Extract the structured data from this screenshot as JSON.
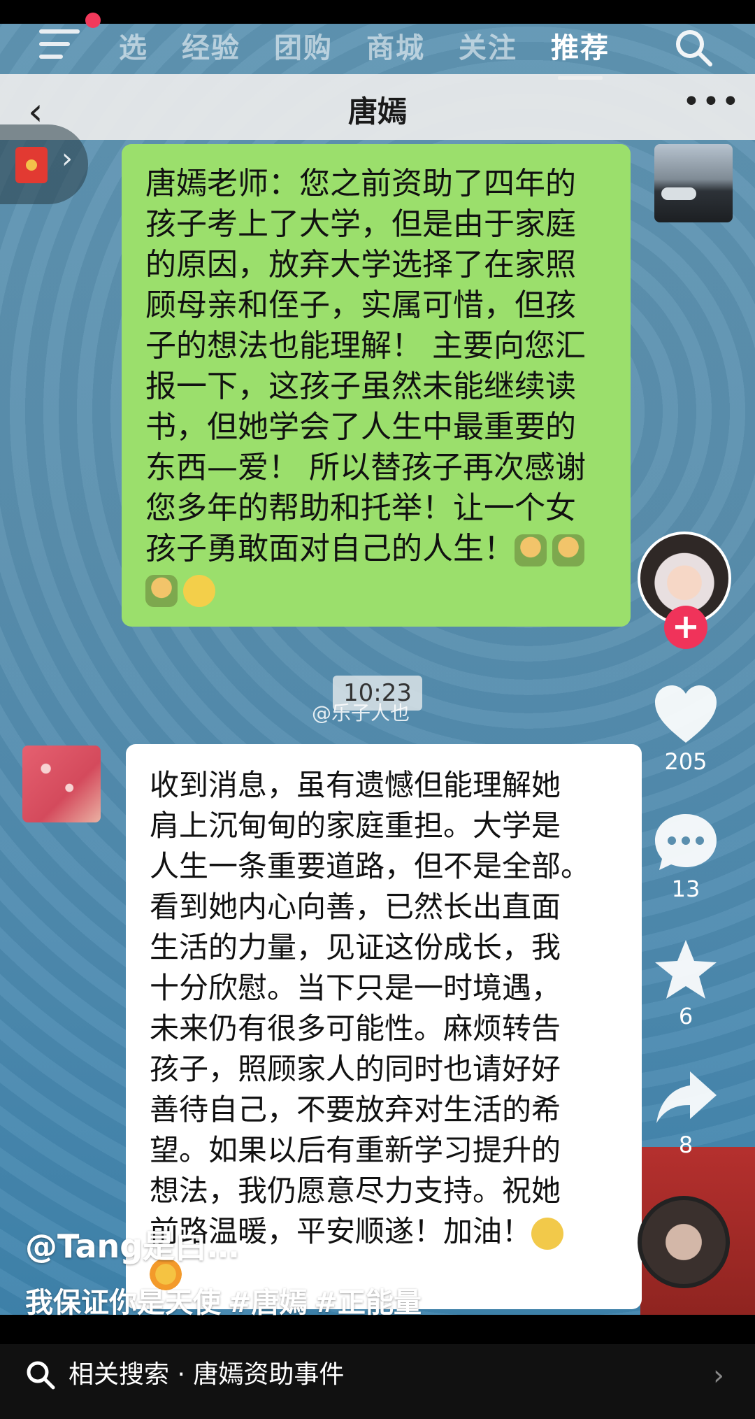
{
  "top_nav": {
    "tabs": [
      "选",
      "经验",
      "团购",
      "商城",
      "关注",
      "推荐"
    ],
    "active_tab": "推荐"
  },
  "chat": {
    "title": "唐嫣",
    "back_icon": "back-chevron-icon",
    "more_icon": "more-dots-icon",
    "timestamp": "10:23",
    "watermark": "@乐子人也",
    "sent_message_lines": [
      "唐嫣老师：您之前资助了四年的",
      "孩子考上了大学，但是由于家庭",
      "的原因，放弃大学选择了在家照",
      "顾母亲和侄子，实属可惜，但孩",
      "子的想法也能理解！ 主要向您汇",
      "报一下，这孩子虽然未能继续读",
      "书，但她学会了人生中最重要的",
      "东西—爱！ 所以替孩子再次感谢",
      "您多年的帮助和托举！让一个女",
      "孩子勇敢面对自己的人生！"
    ],
    "reply_message_lines": [
      "收到消息，虽有遗憾但能理解她",
      "肩上沉甸甸的家庭重担。大学是",
      "人生一条重要道路，但不是全部。",
      "看到她内心向善，已然长出直面",
      "生活的力量，见证这份成长，我",
      "十分欣慰。当下只是一时境遇，",
      "未来仍有很多可能性。麻烦转告",
      "孩子，照顾家人的同时也请好好",
      "善待自己，不要放弃对生活的希",
      "望。如果以后有重新学习提升的",
      "想法，我仍愿意尽力支持。祝她",
      "前路温暖，平安顺遂！加油！"
    ]
  },
  "actions": {
    "likes": "205",
    "comments": "13",
    "favorites": "6",
    "shares": "8"
  },
  "post": {
    "author": "@Tang是白…",
    "caption": "我保证你是天使",
    "tags": [
      "#唐嫣",
      "#正能量"
    ]
  },
  "bottom": {
    "related_search": "相关搜索 · 唐嫣资助事件"
  }
}
